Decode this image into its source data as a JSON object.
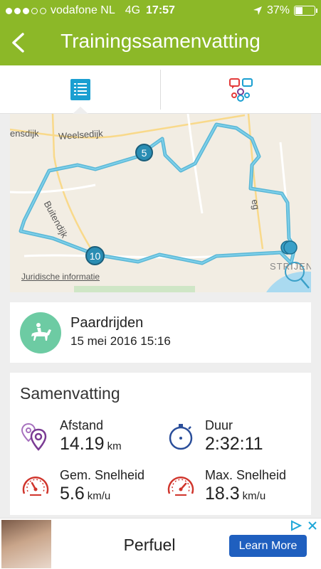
{
  "status_bar": {
    "carrier": "vodafone NL",
    "network": "4G",
    "time": "17:57",
    "battery": "37%"
  },
  "header": {
    "title": "Trainingssamenvatting"
  },
  "tabs": [
    {
      "name": "list",
      "icon": "list-icon",
      "active": true
    },
    {
      "name": "social",
      "icon": "social-share-icon",
      "active": false
    }
  ],
  "map": {
    "legal_link": "Juridische informatie",
    "labels": [
      "ensdijk",
      "Weelsedijk",
      "Buitendijk",
      "eg",
      "STRIJEN"
    ],
    "markers": [
      "5",
      "10"
    ],
    "route_color": "#5ab7d6"
  },
  "activity": {
    "icon": "horse-riding-icon",
    "name": "Paardrijden",
    "datetime": "15 mei 2016 15:16",
    "color": "#6dcba3"
  },
  "summary": {
    "title": "Samenvatting",
    "stats": [
      {
        "label": "Afstand",
        "value": "14.19",
        "unit": "km",
        "icon": "distance-pin-icon"
      },
      {
        "label": "Duur",
        "value": "2:32:11",
        "unit": "",
        "icon": "stopwatch-icon"
      },
      {
        "label": "Gem. Snelheid",
        "value": "5.6",
        "unit": "km/u",
        "icon": "speedometer-icon"
      },
      {
        "label": "Max. Snelheid",
        "value": "18.3",
        "unit": "km/u",
        "icon": "speedometer-icon"
      }
    ]
  },
  "ad": {
    "brand": "Perfuel",
    "cta": "Learn More"
  },
  "colors": {
    "header_green": "#8cb828",
    "accent_blue": "#1a9fd1",
    "speed_red": "#d0352c",
    "distance_purple": "#7a3b93"
  }
}
